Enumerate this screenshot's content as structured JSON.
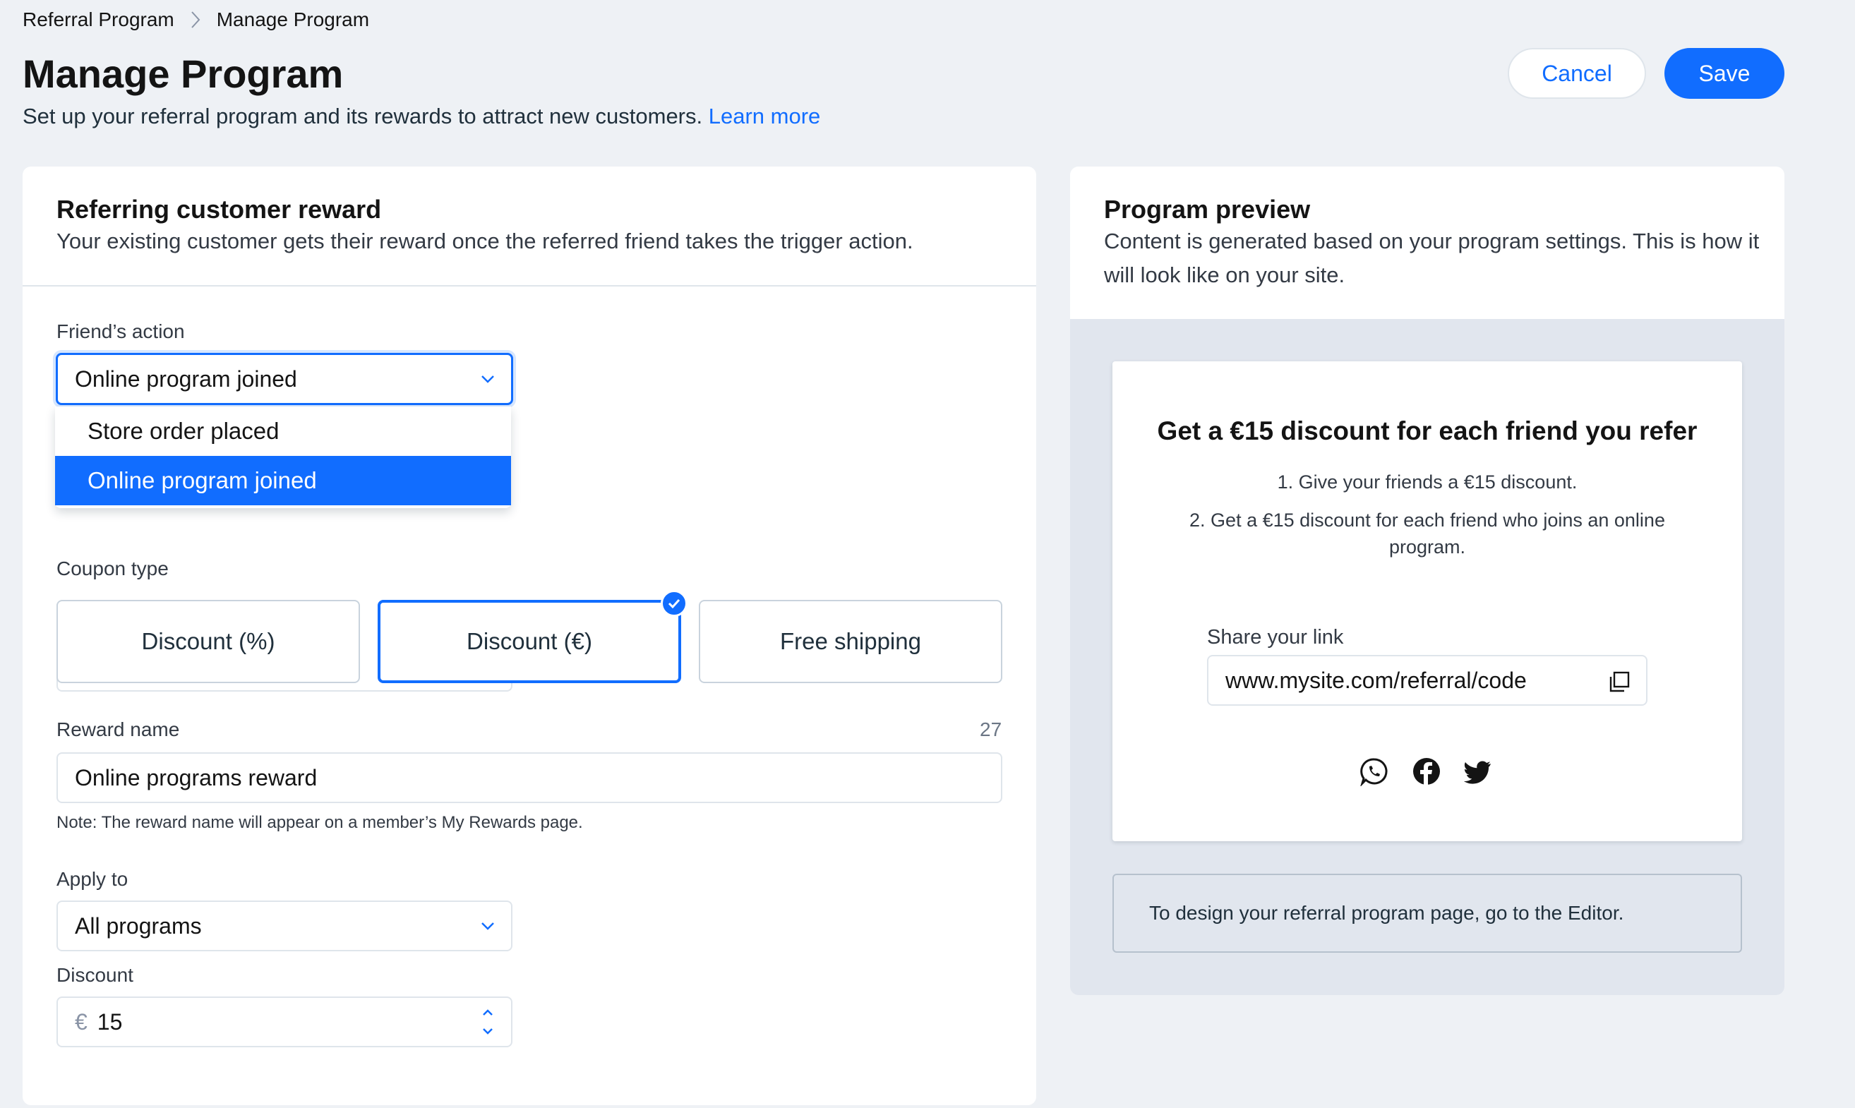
{
  "breadcrumb": {
    "parent": "Referral Program",
    "current": "Manage Program"
  },
  "header": {
    "title": "Manage Program",
    "subtitle": "Set up your referral program and its rewards to attract new customers.",
    "learn_more": "Learn more",
    "cancel_label": "Cancel",
    "save_label": "Save"
  },
  "reward_card": {
    "title": "Referring customer reward",
    "subtitle": "Your existing customer gets their reward once the referred friend takes the trigger action.",
    "friends_action": {
      "label": "Friend’s action",
      "value": "Online program joined",
      "options": [
        "Store order placed",
        "Online program joined"
      ],
      "selected_option": "Online program joined"
    },
    "coupon_type": {
      "label": "Coupon type",
      "options": [
        "Discount (%)",
        "Discount (€)",
        "Free shipping"
      ],
      "selected": "Discount (€)"
    },
    "reward_name": {
      "label": "Reward name",
      "counter": "27",
      "value": "Online programs reward",
      "note": "Note: The reward name will appear on a member’s My Rewards page."
    },
    "apply_to": {
      "label": "Apply to",
      "value": "All programs"
    },
    "discount": {
      "label": "Discount",
      "currency": "€",
      "value": "15"
    }
  },
  "preview_card": {
    "title": "Program preview",
    "subtitle": "Content is generated based on your program settings. This is how it will look like on your site.",
    "heading": "Get a €15 discount for each friend you refer",
    "step1": "1. Give your friends a €15 discount.",
    "step2": "2. Get a €15 discount for each friend who joins an online program.",
    "share_label": "Share your link",
    "share_link": "www.mysite.com/referral/code",
    "social_icons": [
      "whatsapp-icon",
      "facebook-icon",
      "twitter-icon"
    ],
    "editor_note": "To design your referral program page, go to the Editor."
  },
  "colors": {
    "accent": "#116dff",
    "background": "#eef1f5",
    "preview_background": "#e1e6ee"
  }
}
